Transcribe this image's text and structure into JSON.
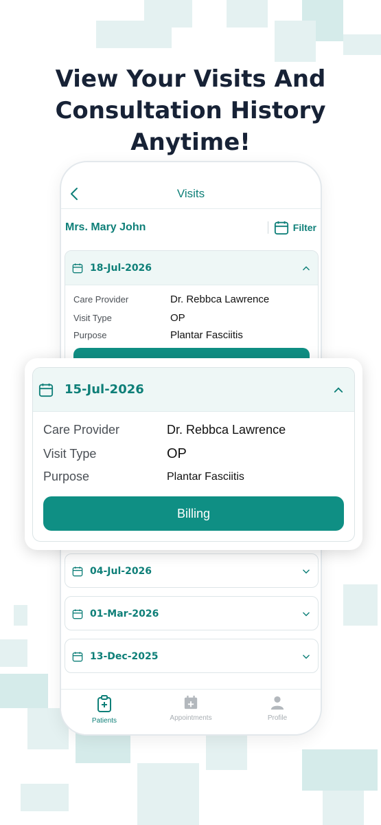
{
  "headline": {
    "line1": "View Your Visits And",
    "line2": "Consultation History Anytime!"
  },
  "header": {
    "title": "Visits",
    "back_icon": "chevron-left-icon"
  },
  "patient": {
    "name": "Mrs. Mary John"
  },
  "filter": {
    "label": "Filter",
    "icon": "calendar-icon"
  },
  "visits": [
    {
      "date": "18-Jul-2026",
      "expanded": true,
      "details": [
        {
          "key": "Care Provider",
          "value": "Dr. Rebbca Lawrence"
        },
        {
          "key": "Visit Type",
          "value": "OP"
        },
        {
          "key": "Purpose",
          "value": "Plantar Fasciitis"
        }
      ]
    },
    {
      "date": "04-Jul-2026",
      "expanded": false
    },
    {
      "date": "01-Mar-2026",
      "expanded": false
    },
    {
      "date": "13-Dec-2025",
      "expanded": false
    }
  ],
  "zoom_card": {
    "date": "15-Jul-2026",
    "details": [
      {
        "key": "Care Provider",
        "value": "Dr. Rebbca Lawrence"
      },
      {
        "key": "Visit Type",
        "value": "OP"
      },
      {
        "key": "Purpose",
        "value": "Plantar Fasciitis"
      }
    ],
    "billing_label": "Billing"
  },
  "tabbar": {
    "items": [
      {
        "label": "Patients",
        "icon": "clipboard-plus-icon",
        "active": true
      },
      {
        "label": "Appointments",
        "icon": "calendar-plus-icon",
        "active": false
      },
      {
        "label": "Profile",
        "icon": "person-icon",
        "active": false
      }
    ]
  },
  "colors": {
    "accent": "#0e7f78",
    "button": "#0f8f84",
    "headline": "#172236"
  }
}
